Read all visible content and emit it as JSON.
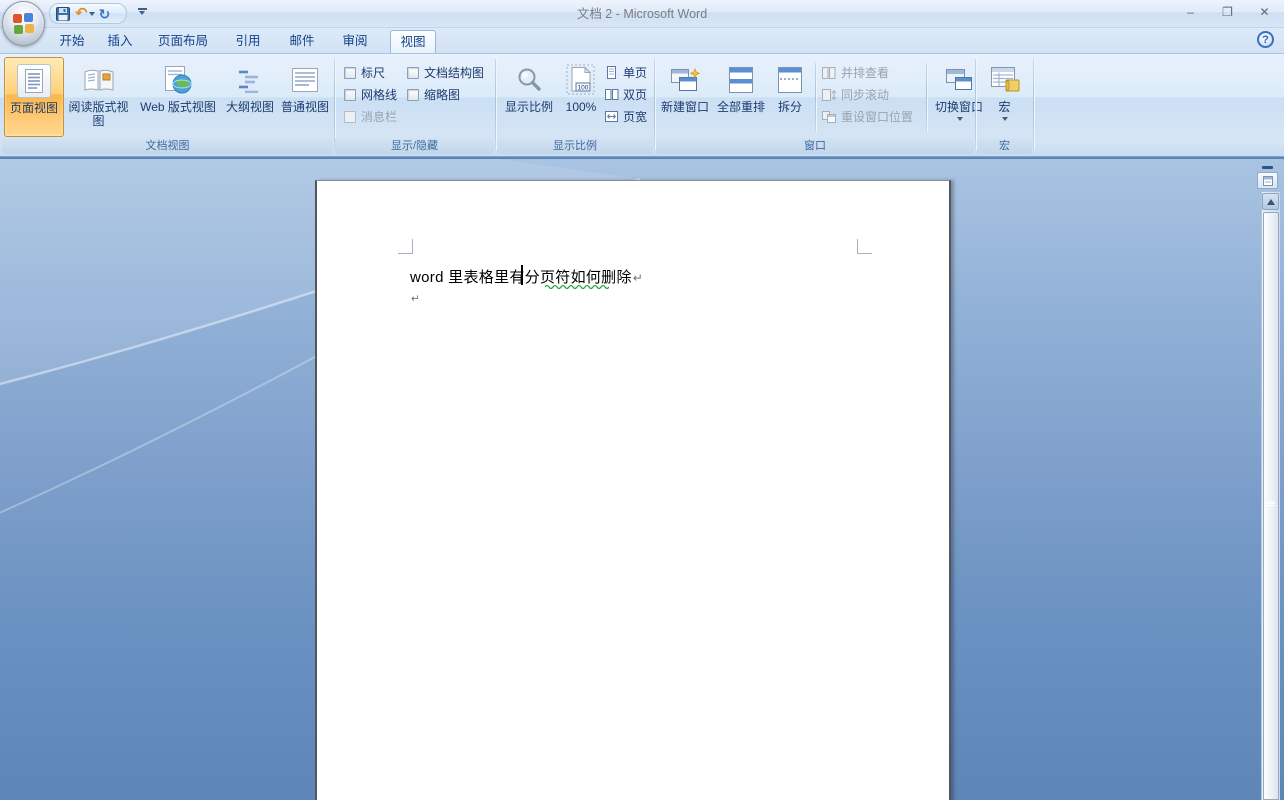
{
  "window_title": "文档 2 - Microsoft Word",
  "titlebar": {
    "minimize": "–",
    "restore": "❐",
    "close": "✕"
  },
  "qat": {
    "undo_glyph": "↶",
    "redo_glyph": "↻"
  },
  "help_label": "?",
  "tabs": [
    "开始",
    "插入",
    "页面布局",
    "引用",
    "邮件",
    "审阅",
    "视图"
  ],
  "active_tab": "视图",
  "ribbon": {
    "document_views": {
      "group_label": "文档视图",
      "print_layout": "页面视图",
      "full_screen_reading": "阅读版式视图",
      "web_layout": "Web 版式视图",
      "outline": "大纲视图",
      "draft": "普通视图"
    },
    "show_hide": {
      "group_label": "显示/隐藏",
      "ruler": "标尺",
      "gridlines": "网格线",
      "message_bar": "消息栏",
      "document_map": "文档结构图",
      "thumbnails": "缩略图"
    },
    "zoom": {
      "group_label": "显示比例",
      "zoom": "显示比例",
      "percent": "100%",
      "one_page": "单页",
      "two_pages": "双页",
      "page_width": "页宽"
    },
    "window": {
      "group_label": "窗口",
      "new_window": "新建窗口",
      "arrange_all": "全部重排",
      "split": "拆分",
      "view_side_by_side": "并排查看",
      "sync_scrolling": "同步滚动",
      "reset_position": "重设窗口位置",
      "switch_windows": "切换窗口"
    },
    "macros": {
      "group_label": "宏",
      "macros": "宏"
    }
  },
  "document": {
    "line1": "word 里表格里有分页符如何删除",
    "pilcrow": "↵"
  },
  "colors": {
    "active_button_orange": "#fcb64b",
    "workspace_top": "#a9c4e2",
    "workspace_bottom": "#5d86b6",
    "squiggle_green": "#23a33b",
    "ribbon_text": "#1e3c6e"
  }
}
